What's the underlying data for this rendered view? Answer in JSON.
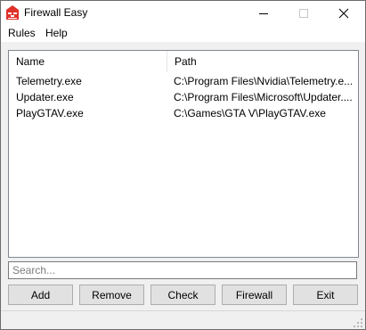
{
  "window": {
    "title": "Firewall Easy"
  },
  "titlebar_buttons": {
    "minimize": "minimize-icon",
    "maximize": "maximize-icon",
    "close": "close-icon"
  },
  "menu": {
    "items": [
      {
        "label": "Rules"
      },
      {
        "label": "Help"
      }
    ]
  },
  "list": {
    "columns": {
      "name": "Name",
      "path": "Path"
    },
    "rows": [
      {
        "name": "Telemetry.exe",
        "path": "C:\\Program Files\\Nvidia\\Telemetry.e..."
      },
      {
        "name": "Updater.exe",
        "path": "C:\\Program Files\\Microsoft\\Updater...."
      },
      {
        "name": "PlayGTAV.exe",
        "path": "C:\\Games\\GTA V\\PlayGTAV.exe"
      }
    ]
  },
  "search": {
    "placeholder": "Search...",
    "value": ""
  },
  "buttons": {
    "add": "Add",
    "remove": "Remove",
    "check": "Check",
    "firewall": "Firewall",
    "exit": "Exit"
  },
  "colors": {
    "app_icon": "#e0322b",
    "list_border": "#828790",
    "button_face": "#e1e1e1"
  }
}
